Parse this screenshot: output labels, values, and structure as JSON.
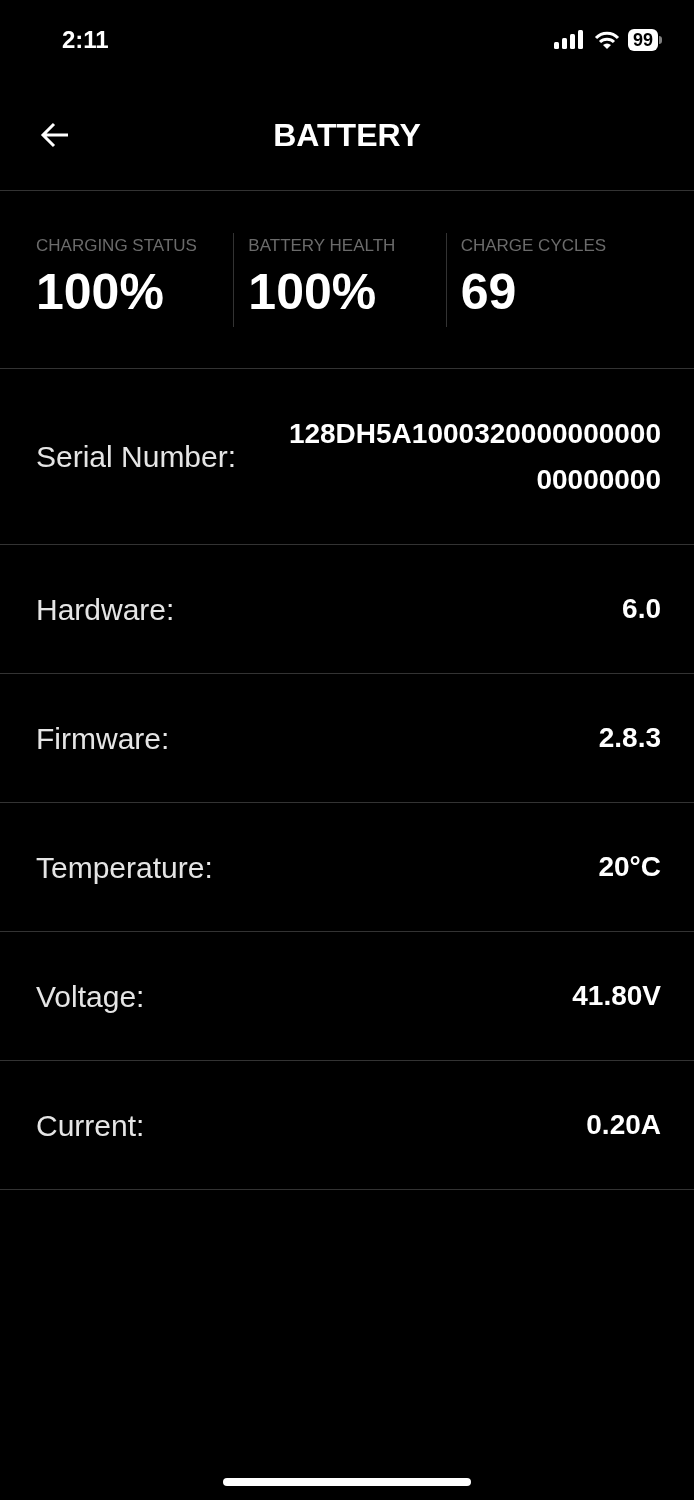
{
  "status_bar": {
    "time": "2:11",
    "battery": "99"
  },
  "header": {
    "title": "BATTERY"
  },
  "stats": [
    {
      "label": "CHARGING STATUS",
      "value": "100%"
    },
    {
      "label": "BATTERY HEALTH",
      "value": "100%"
    },
    {
      "label": "CHARGE CYCLES",
      "value": "69"
    }
  ],
  "details": [
    {
      "label": "Serial Number:",
      "value": "128DH5A100032000000000000000000"
    },
    {
      "label": "Hardware:",
      "value": "6.0"
    },
    {
      "label": "Firmware:",
      "value": "2.8.3"
    },
    {
      "label": "Temperature:",
      "value": "20°C"
    },
    {
      "label": "Voltage:",
      "value": "41.80V"
    },
    {
      "label": "Current:",
      "value": "0.20A"
    }
  ]
}
